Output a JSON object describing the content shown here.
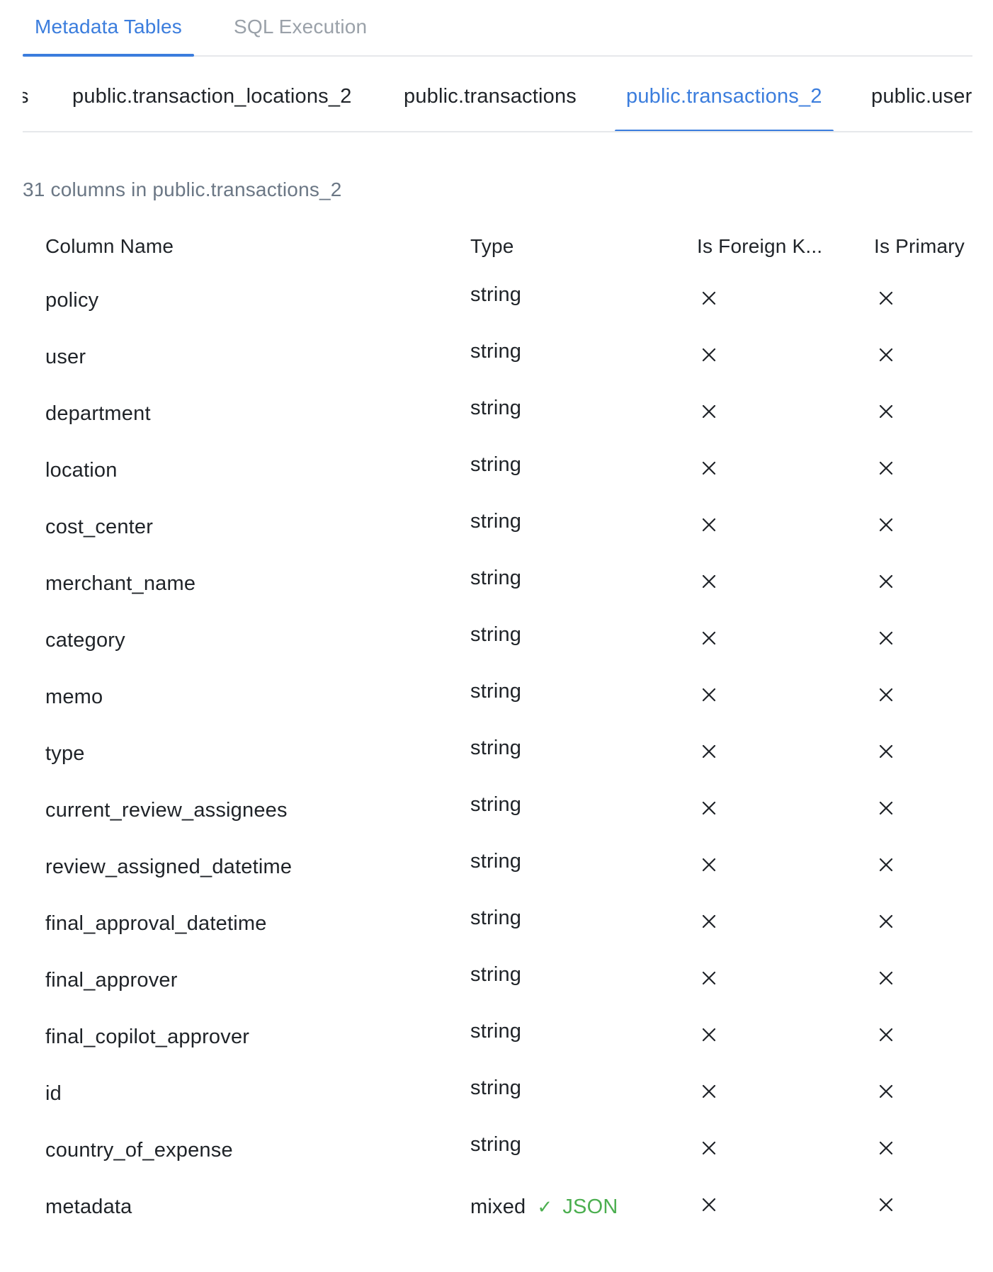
{
  "top_tabs": [
    {
      "label": "Metadata Tables",
      "active": true
    },
    {
      "label": "SQL Execution",
      "active": false
    }
  ],
  "table_tabs": [
    {
      "label": "s",
      "active": false
    },
    {
      "label": "public.transaction_locations_2",
      "active": false
    },
    {
      "label": "public.transactions",
      "active": false
    },
    {
      "label": "public.transactions_2",
      "active": true
    },
    {
      "label": "public.users",
      "active": false
    }
  ],
  "summary": "31 columns in public.transactions_2",
  "columns_header": {
    "name": "Column Name",
    "type": "Type",
    "foreign": "Is Foreign K...",
    "primary": "Is Primary"
  },
  "rows": [
    {
      "name": "policy",
      "type": "string"
    },
    {
      "name": "user",
      "type": "string"
    },
    {
      "name": "department",
      "type": "string"
    },
    {
      "name": "location",
      "type": "string"
    },
    {
      "name": "cost_center",
      "type": "string"
    },
    {
      "name": "merchant_name",
      "type": "string"
    },
    {
      "name": "category",
      "type": "string"
    },
    {
      "name": "memo",
      "type": "string"
    },
    {
      "name": "type",
      "type": "string"
    },
    {
      "name": "current_review_assignees",
      "type": "string"
    },
    {
      "name": "review_assigned_datetime",
      "type": "string"
    },
    {
      "name": "final_approval_datetime",
      "type": "string"
    },
    {
      "name": "final_approver",
      "type": "string"
    },
    {
      "name": "final_copilot_approver",
      "type": "string"
    },
    {
      "name": "id",
      "type": "string"
    },
    {
      "name": "country_of_expense",
      "type": "string"
    },
    {
      "name": "metadata",
      "type": "mixed",
      "badge": {
        "check": "✓",
        "label": "JSON"
      }
    }
  ],
  "colors": {
    "accent": "#3b7ddd",
    "muted": "#9aa1a9",
    "json_badge": "#4caf50"
  },
  "icons": {
    "is_foreign_key": "close-icon",
    "is_primary": "close-icon"
  }
}
